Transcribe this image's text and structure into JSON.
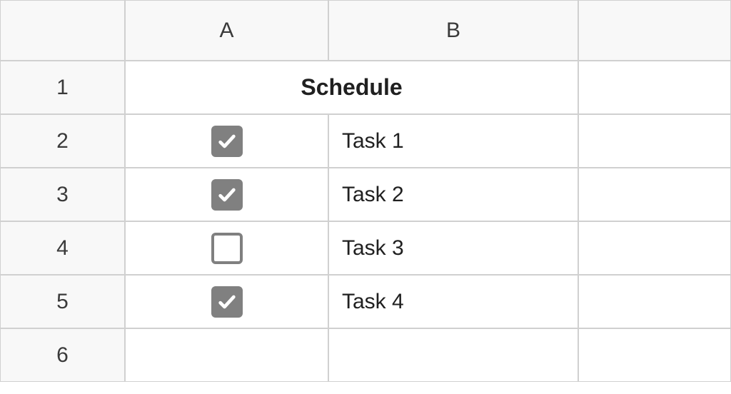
{
  "columns": {
    "a": "A",
    "b": "B"
  },
  "rowHeaders": [
    "1",
    "2",
    "3",
    "4",
    "5",
    "6"
  ],
  "title": "Schedule",
  "tasks": [
    {
      "checked": true,
      "label": "Task 1"
    },
    {
      "checked": true,
      "label": "Task 2"
    },
    {
      "checked": false,
      "label": "Task 3"
    },
    {
      "checked": true,
      "label": "Task 4"
    }
  ]
}
